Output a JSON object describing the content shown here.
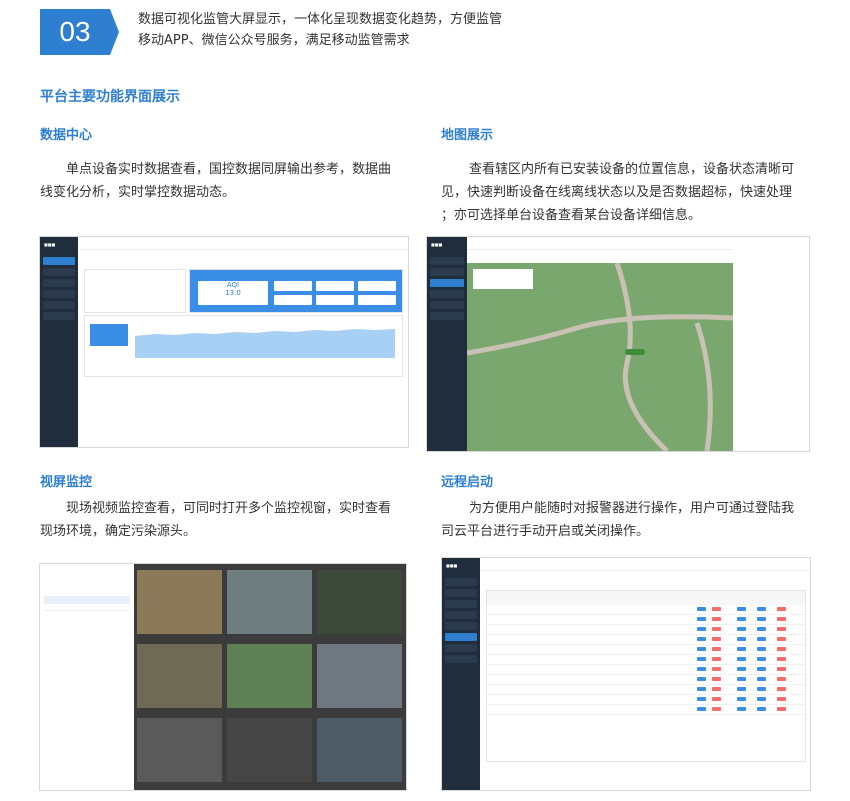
{
  "header": {
    "number": "03",
    "line1": "数据可视化监管大屏显示，一体化呈现数据变化趋势，方便监管",
    "line2": "移动APP、微信公众号服务，满足移动监管需求"
  },
  "section_title": "平台主要功能界面展示",
  "cards": [
    {
      "title": "数据中心",
      "desc_line1": "单点设备实时数据查看，国控数据同屏输出参考，数据曲",
      "desc_line2": "线变化分析，实时掌控数据动态。",
      "shot": {
        "aqi_label": "AQI",
        "aqi_value": "13.0"
      }
    },
    {
      "title": "地图展示",
      "desc_line1": "查看辖区内所有已安装设备的位置信息，设备状态清晰可",
      "desc_line2": "见，快速判断设备在线离线状态以及是否数据超标，快速处理",
      "desc_line3": "；亦可选择单台设备查看某台设备详细信息。"
    },
    {
      "title": "视屏监控",
      "desc_line1": "现场视频监控查看，可同时打开多个监控视窗，实时查看",
      "desc_line2": "现场环境，确定污染源头。"
    },
    {
      "title": "远程启动",
      "desc_line1": "为方便用户能随时对报警器进行操作，用户可通过登陆我",
      "desc_line2": "司云平台进行手动开启或关闭操作。"
    }
  ],
  "colors": {
    "accent": "#2f7fd1",
    "sidebar": "#1f2d3d",
    "map_green": "#7aa76e"
  }
}
